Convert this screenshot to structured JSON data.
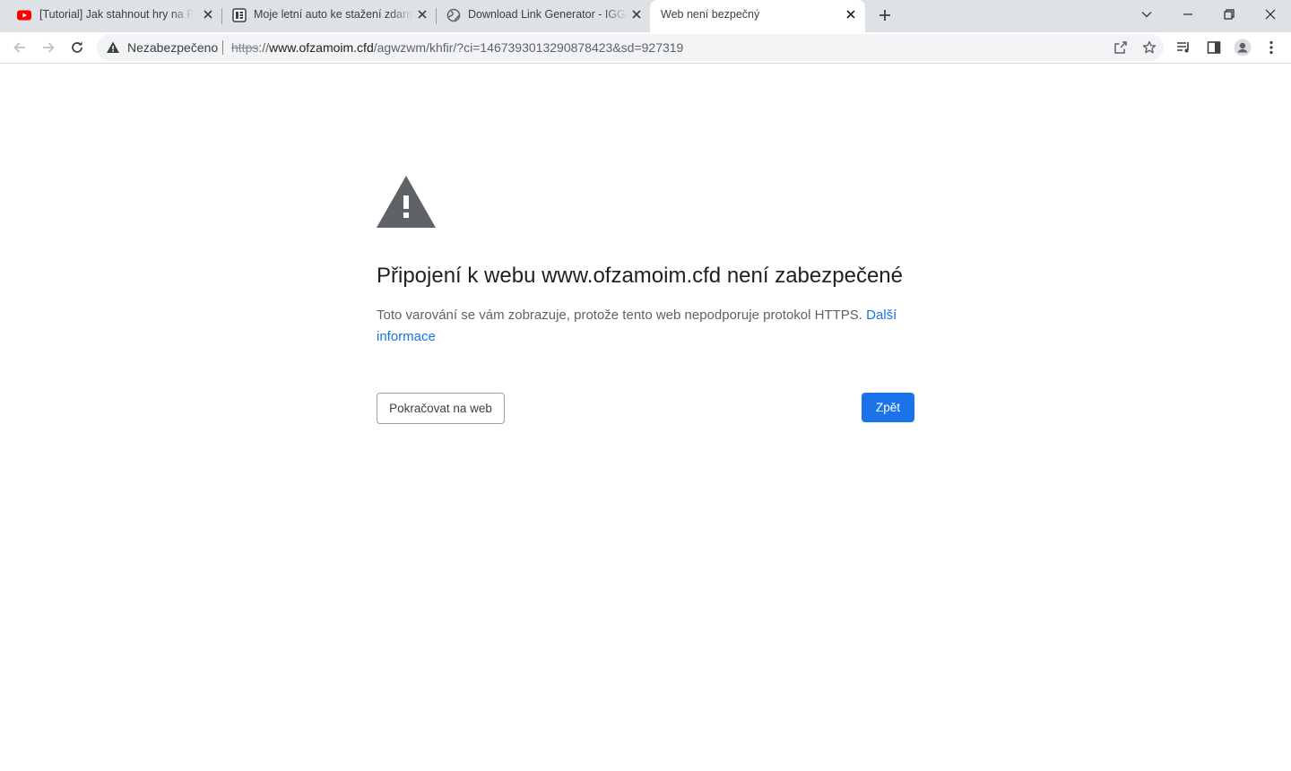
{
  "tabs": [
    {
      "title": "[Tutorial] Jak stahnout hry na PC",
      "icon": "youtube-icon",
      "active": false
    },
    {
      "title": "Moje letní auto ke stažení zdarma",
      "icon": "site-logo-icon",
      "active": false
    },
    {
      "title": "Download Link Generator - IGGG",
      "icon": "globe-icon",
      "active": false
    },
    {
      "title": "Web není bezpečný",
      "icon": "",
      "active": true
    }
  ],
  "omnibox": {
    "security_label": "Nezabezpečeno",
    "url_scheme": "https",
    "url_sep": "://",
    "url_host": "www.ofzamoim.cfd",
    "url_path": "/agwzwm/khfir/?ci=1467393013290878423&sd=927319"
  },
  "page": {
    "heading": "Připojení k webu www.ofzamoim.cfd není zabezpečené",
    "explanation": "Toto varování se vám zobrazuje, protože tento web nepodporuje protokol HTTPS.",
    "learn_more": "Další informace",
    "proceed_button": "Pokračovat na web",
    "back_button": "Zpět"
  },
  "colors": {
    "accent": "#1a73e8",
    "tabstrip": "#dee1e6",
    "warning_icon": "#5f6368"
  }
}
